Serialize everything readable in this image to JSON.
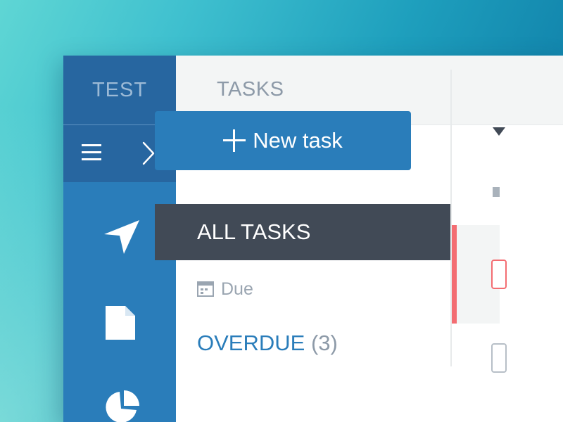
{
  "sidebar": {
    "brand": "TEST",
    "menu_icon": "hamburger-menu-icon",
    "expand_icon": "chevron-right-icon",
    "nav_icons": [
      "navigation-arrow-icon",
      "document-icon",
      "pie-chart-icon"
    ]
  },
  "header": {
    "title": "TASKS"
  },
  "main": {
    "new_task_label": "New task",
    "filter_selected": "ALL TASKS",
    "due_label": "Due",
    "overdue_label": "OVERDUE",
    "overdue_count": "(3)"
  },
  "colors": {
    "sidebar_blue": "#2a7dba",
    "sidebar_dark": "#2766a0",
    "selected_filter": "#414a56",
    "accent_red": "#f36d72"
  }
}
